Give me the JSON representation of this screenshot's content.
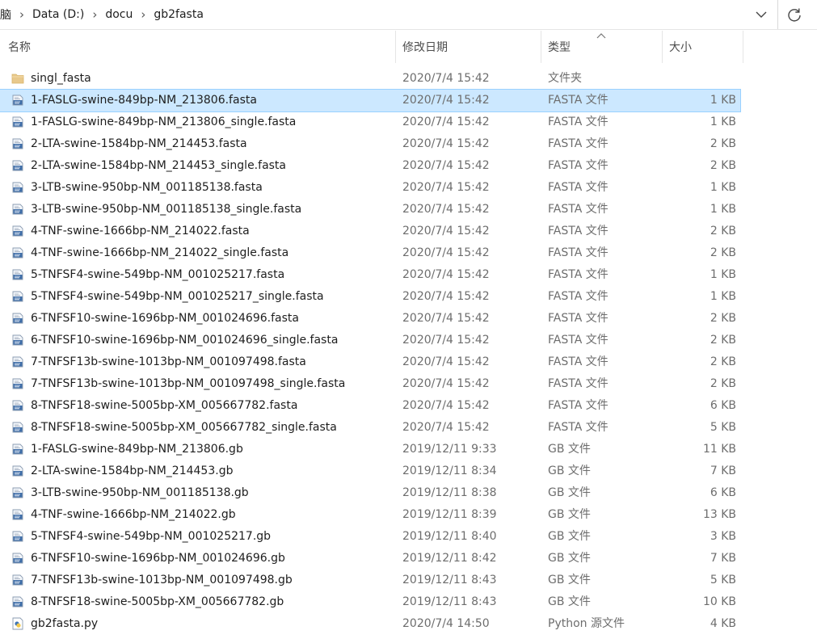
{
  "address": {
    "crumbs": [
      "脑",
      "Data (D:)",
      "docu",
      "gb2fasta"
    ]
  },
  "columns": {
    "name": "名称",
    "date": "修改日期",
    "type": "类型",
    "size": "大小"
  },
  "sort": {
    "column": "type",
    "direction": "ascending"
  },
  "selected_index": 1,
  "files": [
    {
      "name": "singl_fasta",
      "date": "2020/7/4 15:42",
      "type": "文件夹",
      "size": "",
      "icon": "folder-icon"
    },
    {
      "name": "1-FASLG-swine-849bp-NM_213806.fasta",
      "date": "2020/7/4 15:42",
      "type": "FASTA 文件",
      "size": "1 KB",
      "icon": "file-icon"
    },
    {
      "name": "1-FASLG-swine-849bp-NM_213806_single.fasta",
      "date": "2020/7/4 15:42",
      "type": "FASTA 文件",
      "size": "1 KB",
      "icon": "file-icon"
    },
    {
      "name": "2-LTA-swine-1584bp-NM_214453.fasta",
      "date": "2020/7/4 15:42",
      "type": "FASTA 文件",
      "size": "2 KB",
      "icon": "file-icon"
    },
    {
      "name": "2-LTA-swine-1584bp-NM_214453_single.fasta",
      "date": "2020/7/4 15:42",
      "type": "FASTA 文件",
      "size": "2 KB",
      "icon": "file-icon"
    },
    {
      "name": "3-LTB-swine-950bp-NM_001185138.fasta",
      "date": "2020/7/4 15:42",
      "type": "FASTA 文件",
      "size": "1 KB",
      "icon": "file-icon"
    },
    {
      "name": "3-LTB-swine-950bp-NM_001185138_single.fasta",
      "date": "2020/7/4 15:42",
      "type": "FASTA 文件",
      "size": "1 KB",
      "icon": "file-icon"
    },
    {
      "name": "4-TNF-swine-1666bp-NM_214022.fasta",
      "date": "2020/7/4 15:42",
      "type": "FASTA 文件",
      "size": "2 KB",
      "icon": "file-icon"
    },
    {
      "name": "4-TNF-swine-1666bp-NM_214022_single.fasta",
      "date": "2020/7/4 15:42",
      "type": "FASTA 文件",
      "size": "2 KB",
      "icon": "file-icon"
    },
    {
      "name": "5-TNFSF4-swine-549bp-NM_001025217.fasta",
      "date": "2020/7/4 15:42",
      "type": "FASTA 文件",
      "size": "1 KB",
      "icon": "file-icon"
    },
    {
      "name": "5-TNFSF4-swine-549bp-NM_001025217_single.fasta",
      "date": "2020/7/4 15:42",
      "type": "FASTA 文件",
      "size": "1 KB",
      "icon": "file-icon"
    },
    {
      "name": "6-TNFSF10-swine-1696bp-NM_001024696.fasta",
      "date": "2020/7/4 15:42",
      "type": "FASTA 文件",
      "size": "2 KB",
      "icon": "file-icon"
    },
    {
      "name": "6-TNFSF10-swine-1696bp-NM_001024696_single.fasta",
      "date": "2020/7/4 15:42",
      "type": "FASTA 文件",
      "size": "2 KB",
      "icon": "file-icon"
    },
    {
      "name": "7-TNFSF13b-swine-1013bp-NM_001097498.fasta",
      "date": "2020/7/4 15:42",
      "type": "FASTA 文件",
      "size": "2 KB",
      "icon": "file-icon"
    },
    {
      "name": "7-TNFSF13b-swine-1013bp-NM_001097498_single.fasta",
      "date": "2020/7/4 15:42",
      "type": "FASTA 文件",
      "size": "2 KB",
      "icon": "file-icon"
    },
    {
      "name": "8-TNFSF18-swine-5005bp-XM_005667782.fasta",
      "date": "2020/7/4 15:42",
      "type": "FASTA 文件",
      "size": "6 KB",
      "icon": "file-icon"
    },
    {
      "name": "8-TNFSF18-swine-5005bp-XM_005667782_single.fasta",
      "date": "2020/7/4 15:42",
      "type": "FASTA 文件",
      "size": "5 KB",
      "icon": "file-icon"
    },
    {
      "name": "1-FASLG-swine-849bp-NM_213806.gb",
      "date": "2019/12/11 9:33",
      "type": "GB 文件",
      "size": "11 KB",
      "icon": "file-icon"
    },
    {
      "name": "2-LTA-swine-1584bp-NM_214453.gb",
      "date": "2019/12/11 8:34",
      "type": "GB 文件",
      "size": "7 KB",
      "icon": "file-icon"
    },
    {
      "name": "3-LTB-swine-950bp-NM_001185138.gb",
      "date": "2019/12/11 8:38",
      "type": "GB 文件",
      "size": "6 KB",
      "icon": "file-icon"
    },
    {
      "name": "4-TNF-swine-1666bp-NM_214022.gb",
      "date": "2019/12/11 8:39",
      "type": "GB 文件",
      "size": "13 KB",
      "icon": "file-icon"
    },
    {
      "name": "5-TNFSF4-swine-549bp-NM_001025217.gb",
      "date": "2019/12/11 8:40",
      "type": "GB 文件",
      "size": "3 KB",
      "icon": "file-icon"
    },
    {
      "name": "6-TNFSF10-swine-1696bp-NM_001024696.gb",
      "date": "2019/12/11 8:42",
      "type": "GB 文件",
      "size": "7 KB",
      "icon": "file-icon"
    },
    {
      "name": "7-TNFSF13b-swine-1013bp-NM_001097498.gb",
      "date": "2019/12/11 8:43",
      "type": "GB 文件",
      "size": "5 KB",
      "icon": "file-icon"
    },
    {
      "name": "8-TNFSF18-swine-5005bp-XM_005667782.gb",
      "date": "2019/12/11 8:43",
      "type": "GB 文件",
      "size": "10 KB",
      "icon": "file-icon"
    },
    {
      "name": "gb2fasta.py",
      "date": "2020/7/4 14:50",
      "type": "Python 源文件",
      "size": "4 KB",
      "icon": "python-file-icon"
    }
  ]
}
